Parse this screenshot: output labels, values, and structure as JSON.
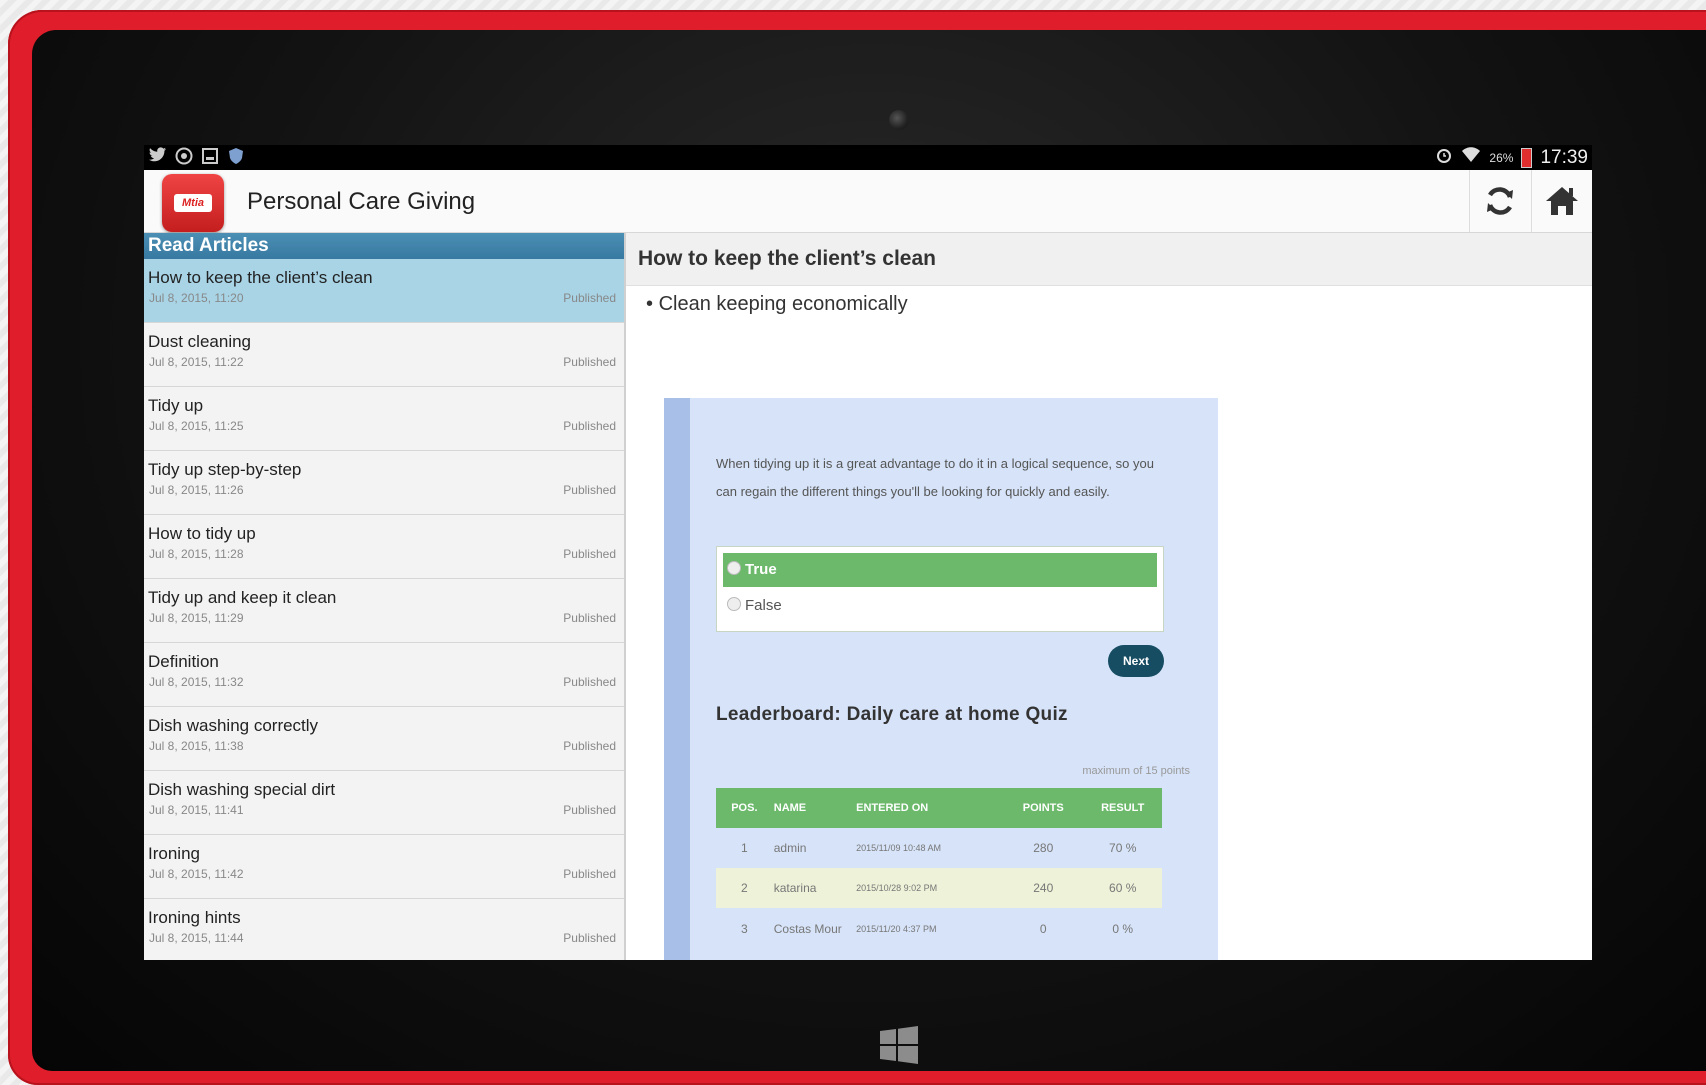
{
  "status_bar": {
    "left_icons": [
      "twitter-icon",
      "chrome-icon",
      "notes-icon",
      "android-shield-icon"
    ],
    "right_icons": [
      "alarm-icon",
      "wifi-icon"
    ],
    "battery": "26%",
    "time": "17:39"
  },
  "action_bar": {
    "logo_text": "Mtia",
    "title": "Personal Care Giving",
    "refresh_icon": "refresh-icon",
    "home_icon": "home-icon"
  },
  "sidebar": {
    "header": "Read Articles",
    "articles": [
      {
        "title": "How to keep the client’s  clean",
        "date": "Jul 8, 2015, 11:20",
        "status": "Published"
      },
      {
        "title": "Dust cleaning",
        "date": "Jul 8, 2015, 11:22",
        "status": "Published"
      },
      {
        "title": "Tidy up",
        "date": "Jul 8, 2015, 11:25",
        "status": "Published"
      },
      {
        "title": "Tidy up step-by-step",
        "date": "Jul 8, 2015, 11:26",
        "status": "Published"
      },
      {
        "title": "How to tidy up",
        "date": "Jul 8, 2015, 11:28",
        "status": "Published"
      },
      {
        "title": "Tidy up and keep it clean",
        "date": "Jul 8, 2015, 11:29",
        "status": "Published"
      },
      {
        "title": "Definition",
        "date": "Jul 8, 2015, 11:32",
        "status": "Published"
      },
      {
        "title": "Dish washing correctly",
        "date": "Jul 8, 2015, 11:38",
        "status": "Published"
      },
      {
        "title": "Dish washing special dirt",
        "date": "Jul 8, 2015, 11:41",
        "status": "Published"
      },
      {
        "title": "Ironing",
        "date": "Jul 8, 2015, 11:42",
        "status": "Published"
      },
      {
        "title": "Ironing hints",
        "date": "Jul 8, 2015, 11:44",
        "status": "Published"
      }
    ]
  },
  "article": {
    "heading": "How to keep the client’s  clean",
    "bullet": "Clean keeping economically",
    "quiz": {
      "question": "When tidying up it is a great advantage to do it in a logical sequence, so you can regain the different things you'll be looking for quickly and easily.",
      "answer_true": "True",
      "answer_false": "False",
      "next_label": "Next"
    },
    "leaderboard": {
      "title": "Leaderboard: Daily care at home Quiz",
      "max_note": "maximum of 15 points",
      "columns": [
        "POS.",
        "NAME",
        "ENTERED ON",
        "POINTS",
        "RESULT"
      ],
      "rows": [
        {
          "pos": "1",
          "name": "admin",
          "entered": "2015/11/09 10:48 AM",
          "points": "280",
          "result": "70 %"
        },
        {
          "pos": "2",
          "name": "katarina",
          "entered": "2015/10/28 9:02 PM",
          "points": "240",
          "result": "60 %"
        },
        {
          "pos": "3",
          "name": "Costas Mour",
          "entered": "2015/11/20 4:37 PM",
          "points": "0",
          "result": "0 %"
        }
      ]
    }
  },
  "colors": {
    "device_frame": "#e01e2b",
    "sidebar_header": "#3f83ab",
    "selected_row": "#a8d4e6",
    "quiz_green": "#6cb96c",
    "next_button": "#164d63"
  }
}
